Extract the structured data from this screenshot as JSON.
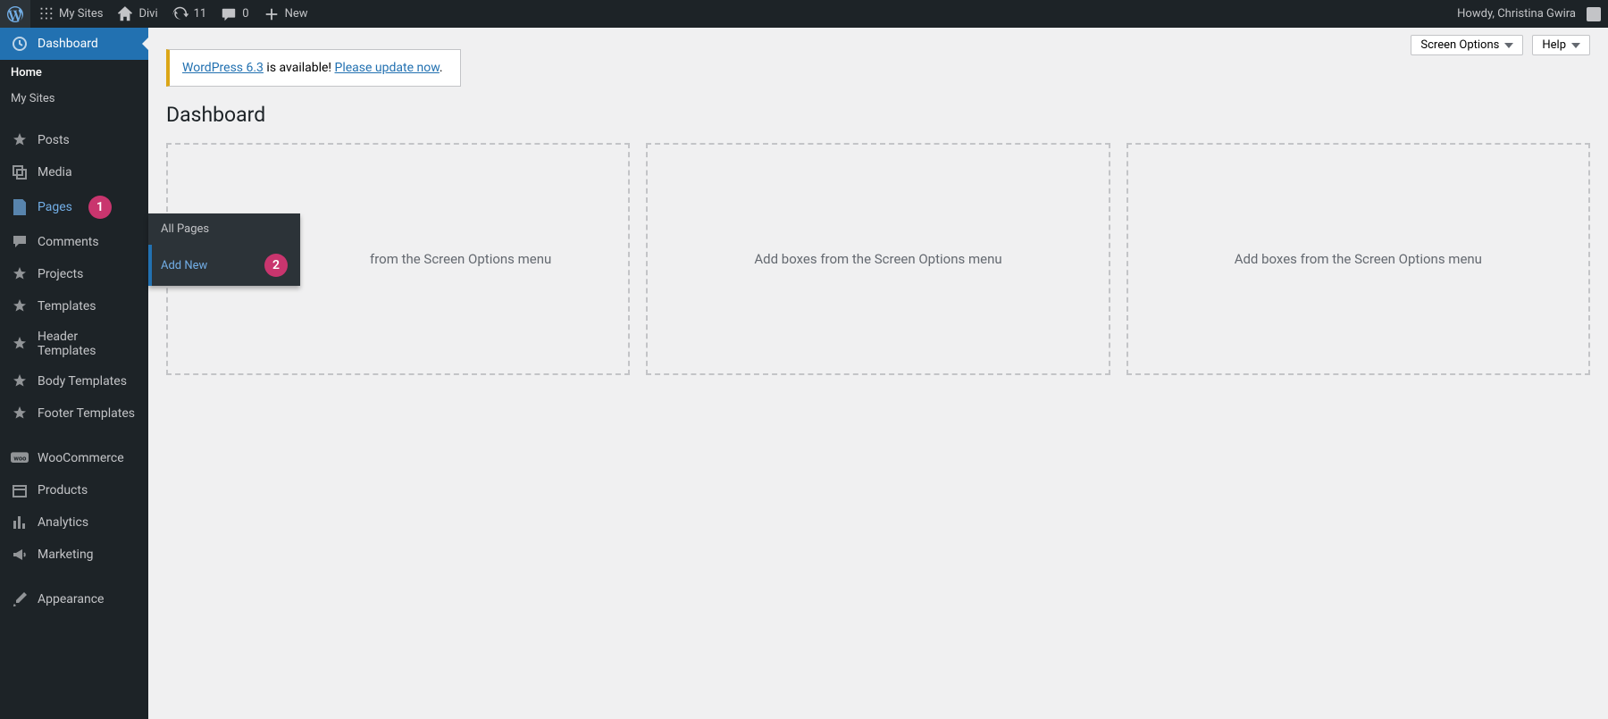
{
  "toolbar": {
    "my_sites": "My Sites",
    "site_name": "Divi",
    "updates": "11",
    "comments": "0",
    "new": "New",
    "howdy": "Howdy, Christina Gwira"
  },
  "sidebar": {
    "dashboard": "Dashboard",
    "sub": {
      "home": "Home",
      "my_sites": "My Sites"
    },
    "items": [
      {
        "label": "Posts",
        "icon": "pin"
      },
      {
        "label": "Media",
        "icon": "media"
      },
      {
        "label": "Pages",
        "icon": "page",
        "highlight": true,
        "badge": "1"
      },
      {
        "label": "Comments",
        "icon": "comment"
      },
      {
        "label": "Projects",
        "icon": "pin"
      },
      {
        "label": "Templates",
        "icon": "pin"
      },
      {
        "label": "Header Templates",
        "icon": "pin"
      },
      {
        "label": "Body Templates",
        "icon": "pin"
      },
      {
        "label": "Footer Templates",
        "icon": "pin"
      }
    ],
    "items2": [
      {
        "label": "WooCommerce",
        "icon": "woo"
      },
      {
        "label": "Products",
        "icon": "products"
      },
      {
        "label": "Analytics",
        "icon": "chart"
      },
      {
        "label": "Marketing",
        "icon": "megaphone"
      }
    ],
    "items3": [
      {
        "label": "Appearance",
        "icon": "brush"
      }
    ]
  },
  "flyout": {
    "all_pages": "All Pages",
    "add_new": "Add New",
    "badge": "2"
  },
  "actions": {
    "screen_options": "Screen Options",
    "help": "Help"
  },
  "notice": {
    "link1": "WordPress 6.3",
    "mid": " is available! ",
    "link2": "Please update now",
    "dot": "."
  },
  "page_title": "Dashboard",
  "box_text": "Add boxes from the Screen Options menu",
  "box_text_clipped": "from the Screen Options menu"
}
